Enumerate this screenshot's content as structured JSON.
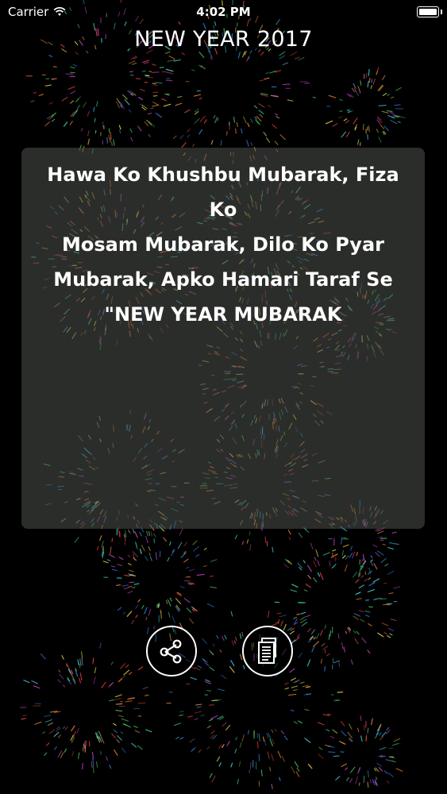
{
  "status_bar": {
    "carrier": "Carrier",
    "time": "4:02 PM",
    "icons": [
      "wifi-icon",
      "battery-icon"
    ]
  },
  "header": {
    "title": "NEW YEAR 2017"
  },
  "card": {
    "message": "Hawa Ko Khushbu Mubarak,  Fiza Ko\nMosam Mubarak,  Dilo Ko Pyar\nMubarak,  Apko Hamari Taraf Se\n\"NEW YEAR MUBARAK"
  },
  "actions": {
    "share_icon": "share-icon",
    "copy_icon": "copy-icon"
  },
  "colors": {
    "background": "#000000",
    "card_overlay": "#4e524c",
    "text": "#ffffff",
    "firework_palette": [
      "#e0d040",
      "#40c060",
      "#3080e0",
      "#e04040",
      "#c040c0",
      "#40d0d0",
      "#f08030"
    ]
  }
}
